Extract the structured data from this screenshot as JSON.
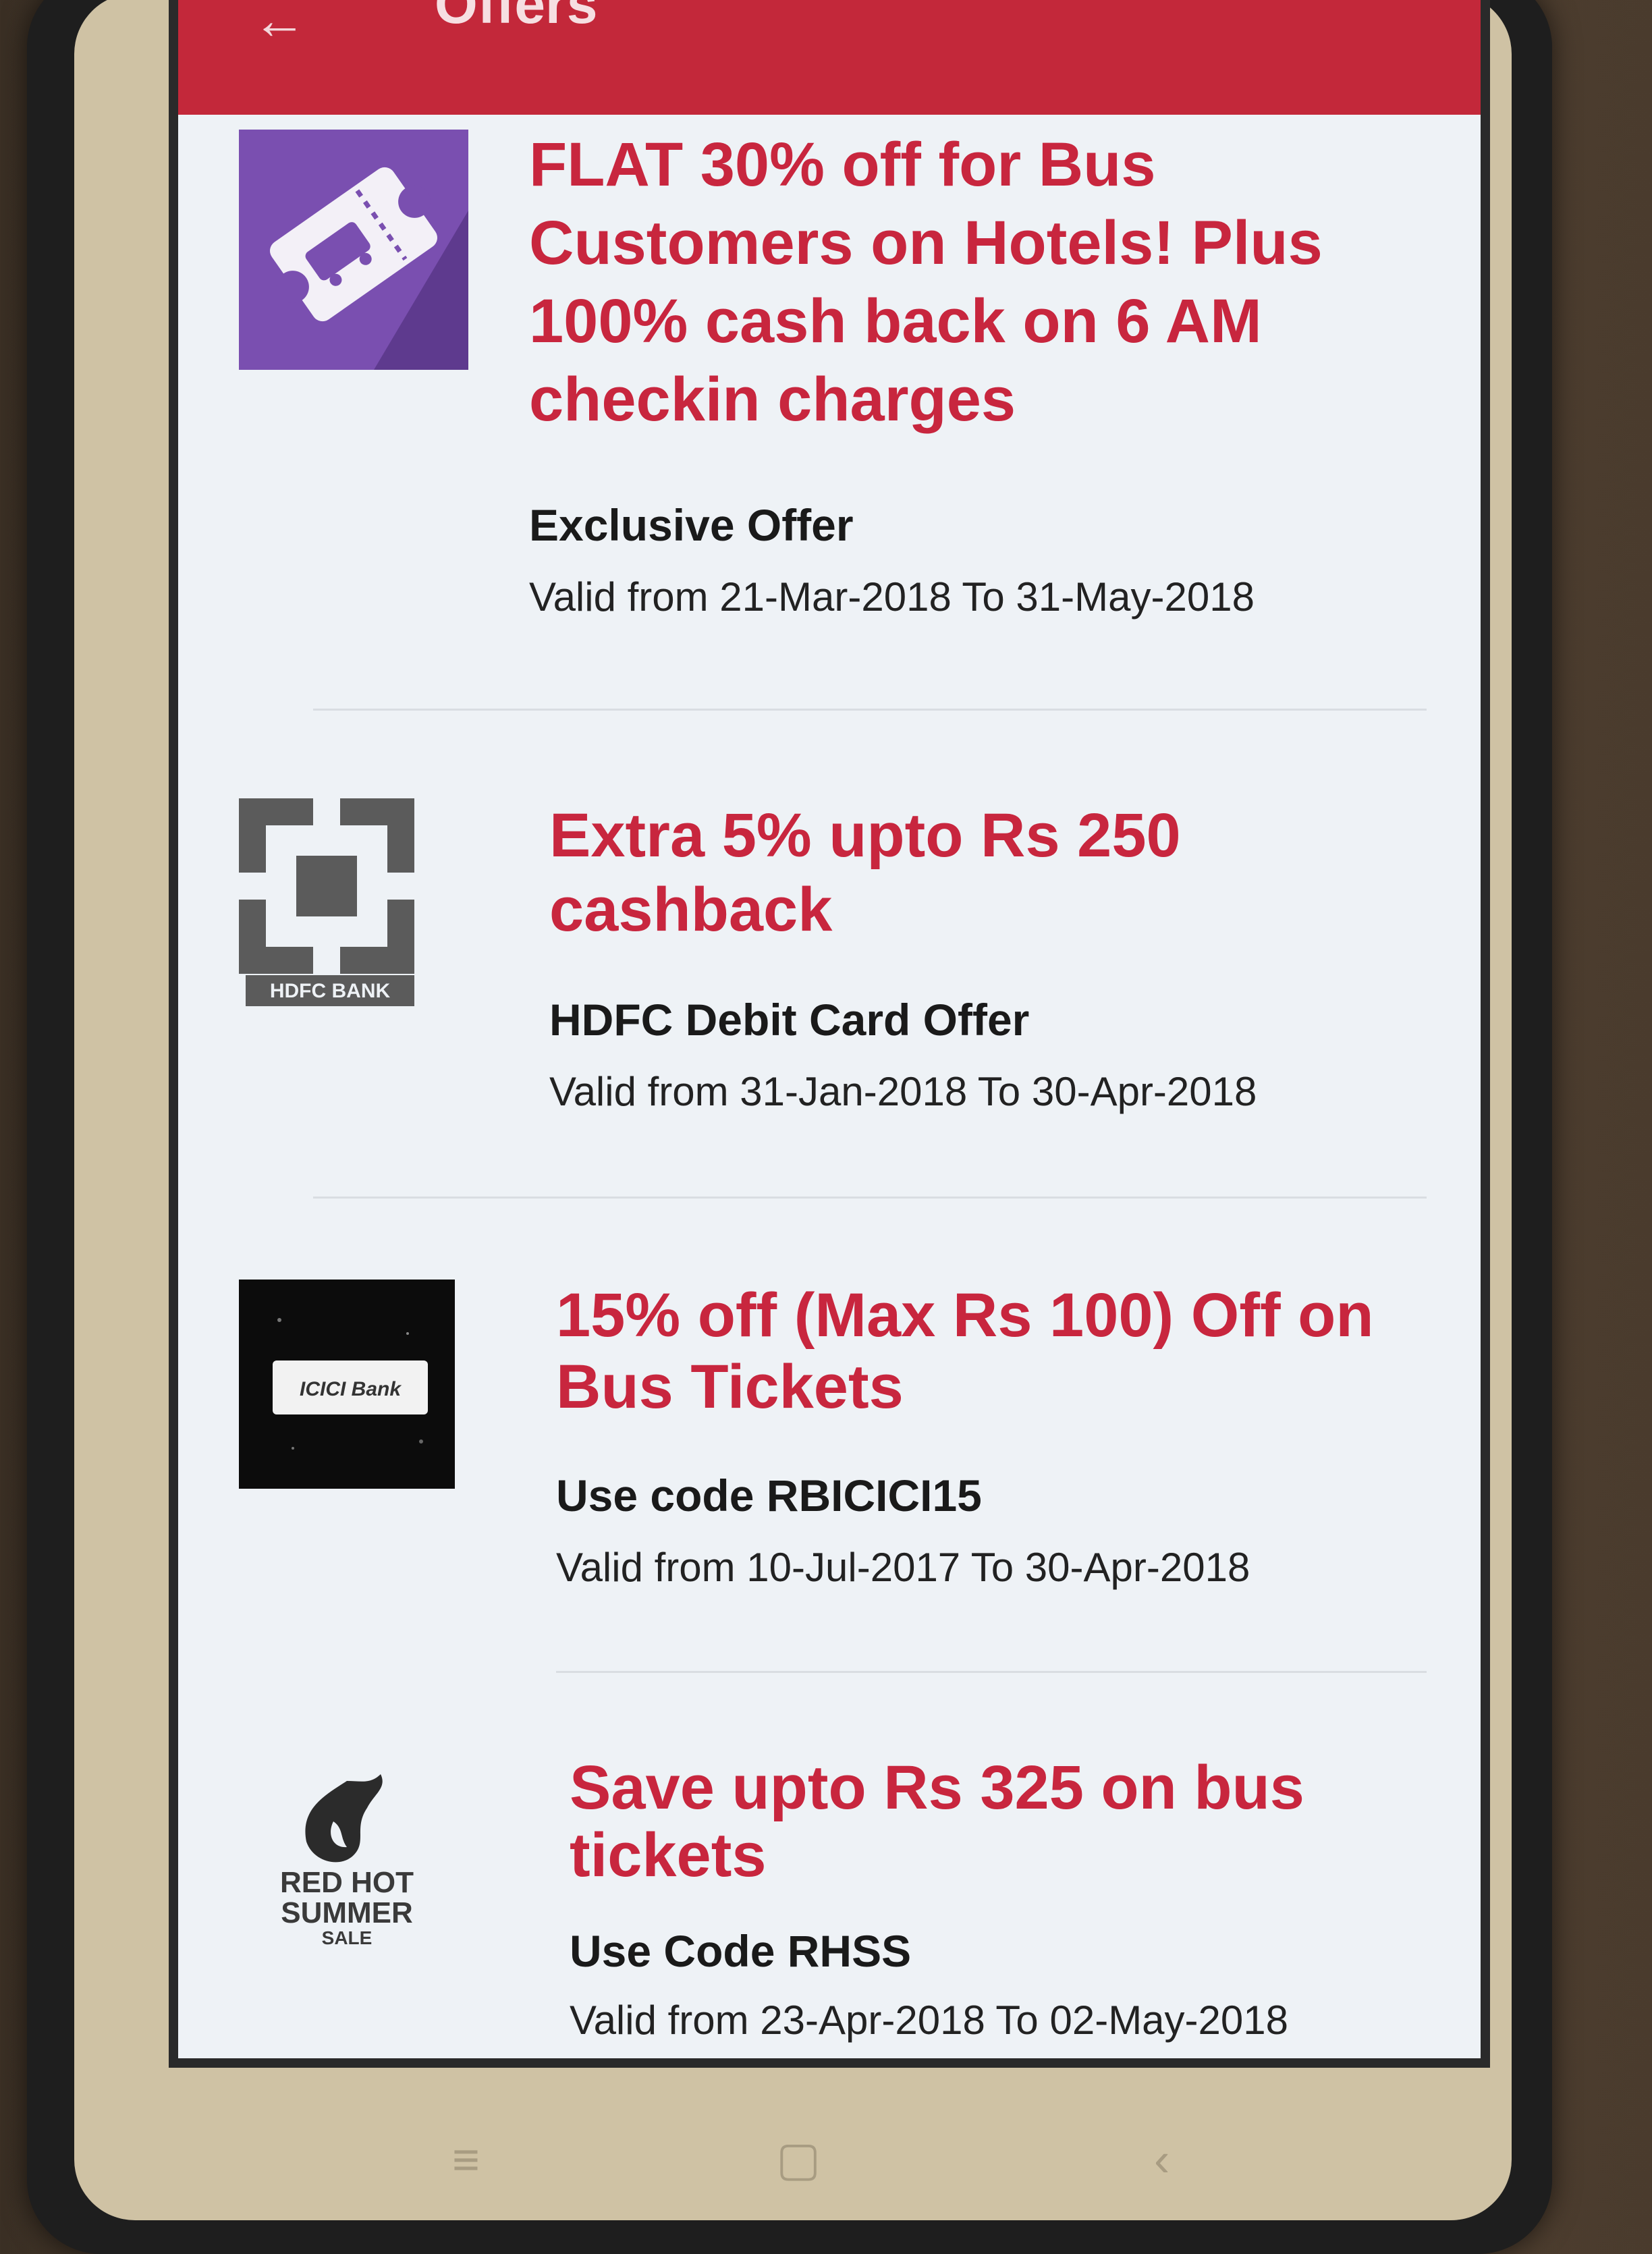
{
  "appbar": {
    "title": "Offers",
    "back_icon": "arrow-left-icon"
  },
  "offers": [
    {
      "title": "FLAT 30% off for Bus Customers on Hotels! Plus 100% cash back on 6 AM checkin charges",
      "subtitle": "Exclusive Offer",
      "validity": "Valid from 21-Mar-2018 To 31-May-2018",
      "logo": "bus-ticket-icon"
    },
    {
      "title": "Extra 5% upto Rs 250 cashback",
      "subtitle": "HDFC Debit Card Offer",
      "validity": "Valid from 31-Jan-2018 To 30-Apr-2018",
      "logo": "hdfc-bank-logo",
      "logo_text": "HDFC BANK"
    },
    {
      "title": "15% off (Max Rs 100) Off on Bus Tickets",
      "subtitle": "Use code RBICICI15",
      "validity": "Valid from 10-Jul-2017 To 30-Apr-2018",
      "logo": "icici-bank-logo",
      "logo_text": "ICICI Bank"
    },
    {
      "title": "Save upto Rs 325 on bus tickets",
      "subtitle": "Use Code RHSS",
      "validity": "Valid from 23-Apr-2018 To 02-May-2018",
      "logo": "red-hot-summer-sale-logo",
      "logo_text": [
        "RED HOT",
        "SUMMER",
        "SALE"
      ]
    }
  ],
  "colors": {
    "appbar": "#c3283a",
    "offer_title": "#c8263e",
    "background": "#eef2f6"
  }
}
